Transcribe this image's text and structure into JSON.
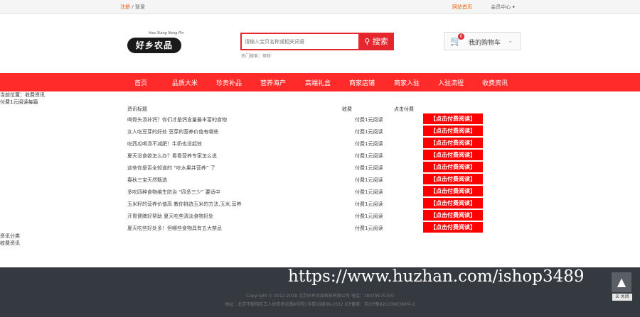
{
  "topbar": {
    "register": "注册",
    "sep": "/",
    "login": "登录",
    "home": "网站首页",
    "member": "会员中心 ▾"
  },
  "logo": {
    "tag": "Hao Xiang Nong Pin",
    "name": "好乡农品"
  },
  "search": {
    "placeholder": "请输入宝贝名称或相关词语",
    "button": "搜索",
    "hot": "热门搜索：茶粉"
  },
  "cart": {
    "count": "0",
    "label": "我的购物车",
    "icon": "cart-icon"
  },
  "nav": [
    "首页",
    "品质大米",
    "珍贵补品",
    "营养海产",
    "高端礼盒",
    "商家店铺",
    "商家入驻",
    "入驻流程",
    "收费资讯"
  ],
  "breadcrumb": [
    "当前位置：收费资讯",
    "付费1元阅读每篇"
  ],
  "table": {
    "headers": [
      "资讯标题",
      "收费",
      "点击付费"
    ],
    "rows": [
      {
        "title": "喝骨头汤补钙？你们才是钙含量最丰富的食物",
        "price": "付费1元阅读"
      },
      {
        "title": "女人吃豆芽的好处 豆芽的营养价值有哪些",
        "price": "付费1元阅读"
      },
      {
        "title": "吃西瓜喝汤不减肥！牛奶也没起效",
        "price": "付费1元阅读"
      },
      {
        "title": "夏天没食欲怎么办？看看营养专家怎么说",
        "price": "付费1元阅读"
      },
      {
        "title": "这些你是否全知道的 “吃水果并营养” 了",
        "price": "付费1元阅读"
      },
      {
        "title": "春秋三宝天然甄选",
        "price": "付费1元阅读"
      },
      {
        "title": "多吃四种食物维生防治 “四多三少” 要适中",
        "price": "付费1元阅读"
      },
      {
        "title": "玉米籽的营养价值高 教你挑选玉米的方法,玉米,营养",
        "price": "付费1元阅读"
      },
      {
        "title": "开胃健脾好帮助 夏天吃些清淡食物好处",
        "price": "付费1元阅读"
      },
      {
        "title": "夏天吃些好处多！但哪些食物具有五大禁忌",
        "price": "付费1元阅读"
      }
    ],
    "button": "【点击付费阅读】"
  },
  "side": [
    "资讯分类",
    "收费资讯"
  ],
  "footer": {
    "watermark": "https://www.huzhan.com/ishop3489",
    "copyright": "Copyright © 2012-2018 北京好乡农品科技有限公司  电话：18078575700",
    "address": "地址：北京市朝阳区工人体育场北路8号院1号楼18层08-2032  ICP备案：京ICP备8201366398号-1"
  },
  "ui": {
    "totop": "▲",
    "close": "☒ 关闭"
  }
}
